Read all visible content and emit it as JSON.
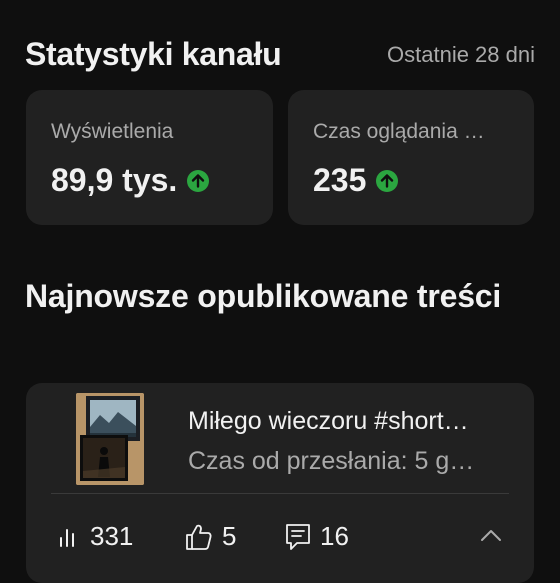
{
  "header": {
    "title": "Statystyki kanału",
    "range": "Ostatnie 28 dni"
  },
  "stats": [
    {
      "label": "Wyświetlenia",
      "value": "89,9 tys.",
      "trend_icon": "arrow-up-circle-icon"
    },
    {
      "label": "Czas oglądania …",
      "value": "235",
      "trend_icon": "arrow-up-circle-icon"
    }
  ],
  "latest": {
    "section_title": "Najnowsze opublikowane treści",
    "video": {
      "title": "Miłego wieczoru #short…",
      "subtitle": "Czas od przesłania: 5 g…",
      "views": "331",
      "likes": "5",
      "comments": "16"
    }
  },
  "colors": {
    "background": "#0f0f0f",
    "card": "#212121",
    "trend_up": "#2ba640",
    "secondary_text": "#aaaaaa"
  }
}
